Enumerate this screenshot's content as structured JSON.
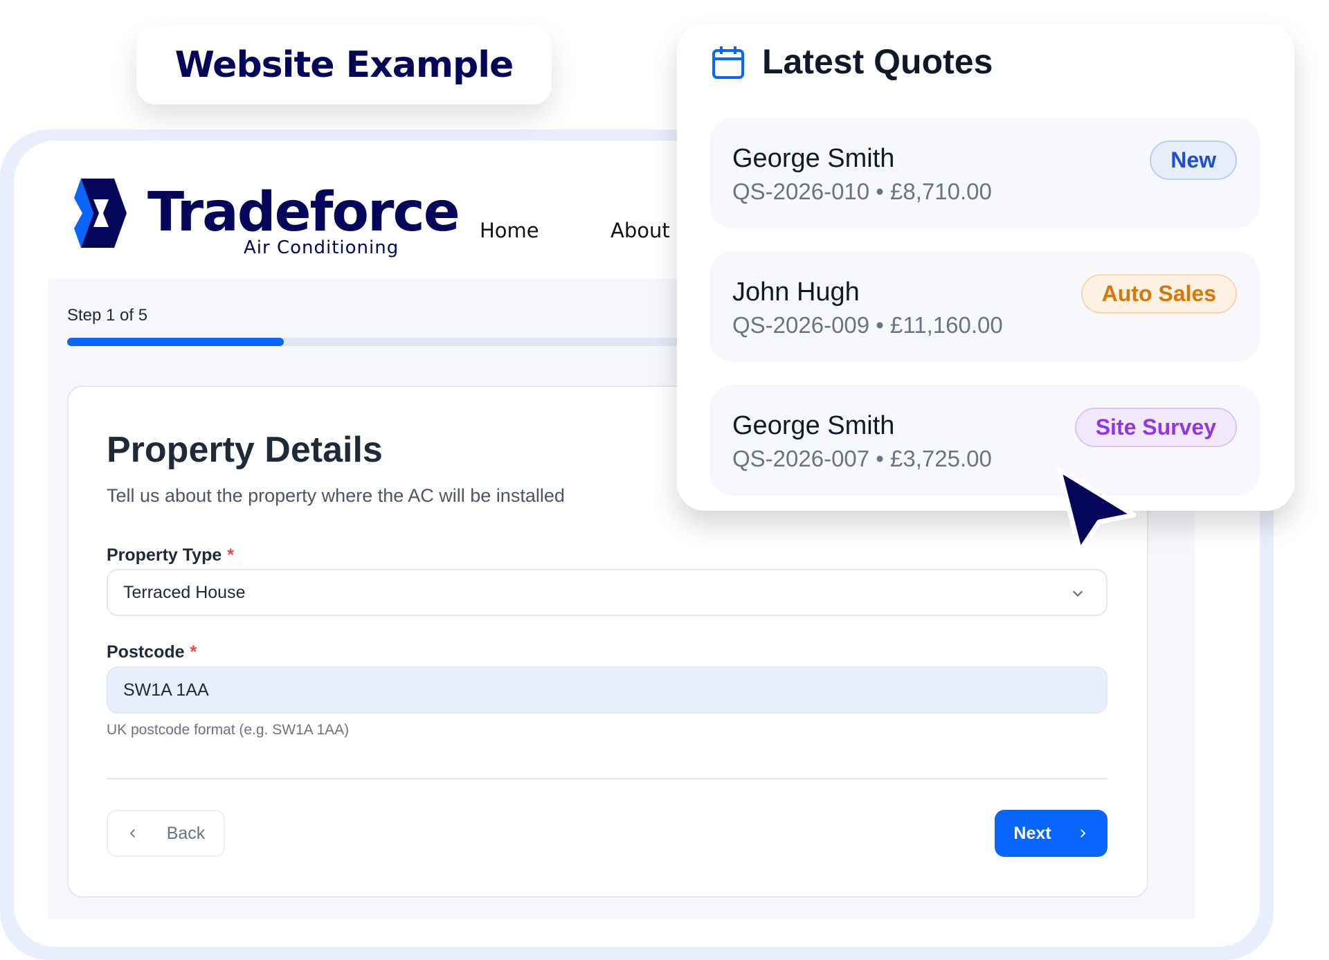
{
  "example_label": "Website Example",
  "brand": {
    "name": "Tradeforce",
    "tagline": "Air Conditioning"
  },
  "nav": [
    {
      "label": "Home"
    },
    {
      "label": "About"
    }
  ],
  "progress": {
    "label": "Step 1 of 5",
    "fraction": 0.2
  },
  "form": {
    "title": "Property Details",
    "subtitle": "Tell us about the property where the AC will be installed",
    "property_type": {
      "label": "Property Type",
      "required": "*",
      "value": "Terraced House"
    },
    "postcode": {
      "label": "Postcode",
      "required": "*",
      "value": "SW1A 1AA",
      "hint": "UK postcode format (e.g. SW1A 1AA)"
    },
    "back_label": "Back",
    "next_label": "Next"
  },
  "quotes": {
    "title": "Latest Quotes",
    "items": [
      {
        "name": "George Smith",
        "meta": "QS-2026-010 • £8,710.00",
        "badge": "New",
        "color": "#1d4ed8",
        "bg": "#e6edfb",
        "border": "#b9cdf5"
      },
      {
        "name": "John Hugh",
        "meta": "QS-2026-009 • £11,160.00",
        "badge": "Auto Sales",
        "color": "#d97706",
        "bg": "#fdf1e4",
        "border": "#f8d6ad"
      },
      {
        "name": "George Smith",
        "meta": "QS-2026-007 • £3,725.00",
        "badge": "Site Survey",
        "color": "#9333ea",
        "bg": "#f1e8fb",
        "border": "#dcc2f6"
      }
    ]
  },
  "colors": {
    "accent": "#0866ff",
    "navy": "#05055a"
  }
}
